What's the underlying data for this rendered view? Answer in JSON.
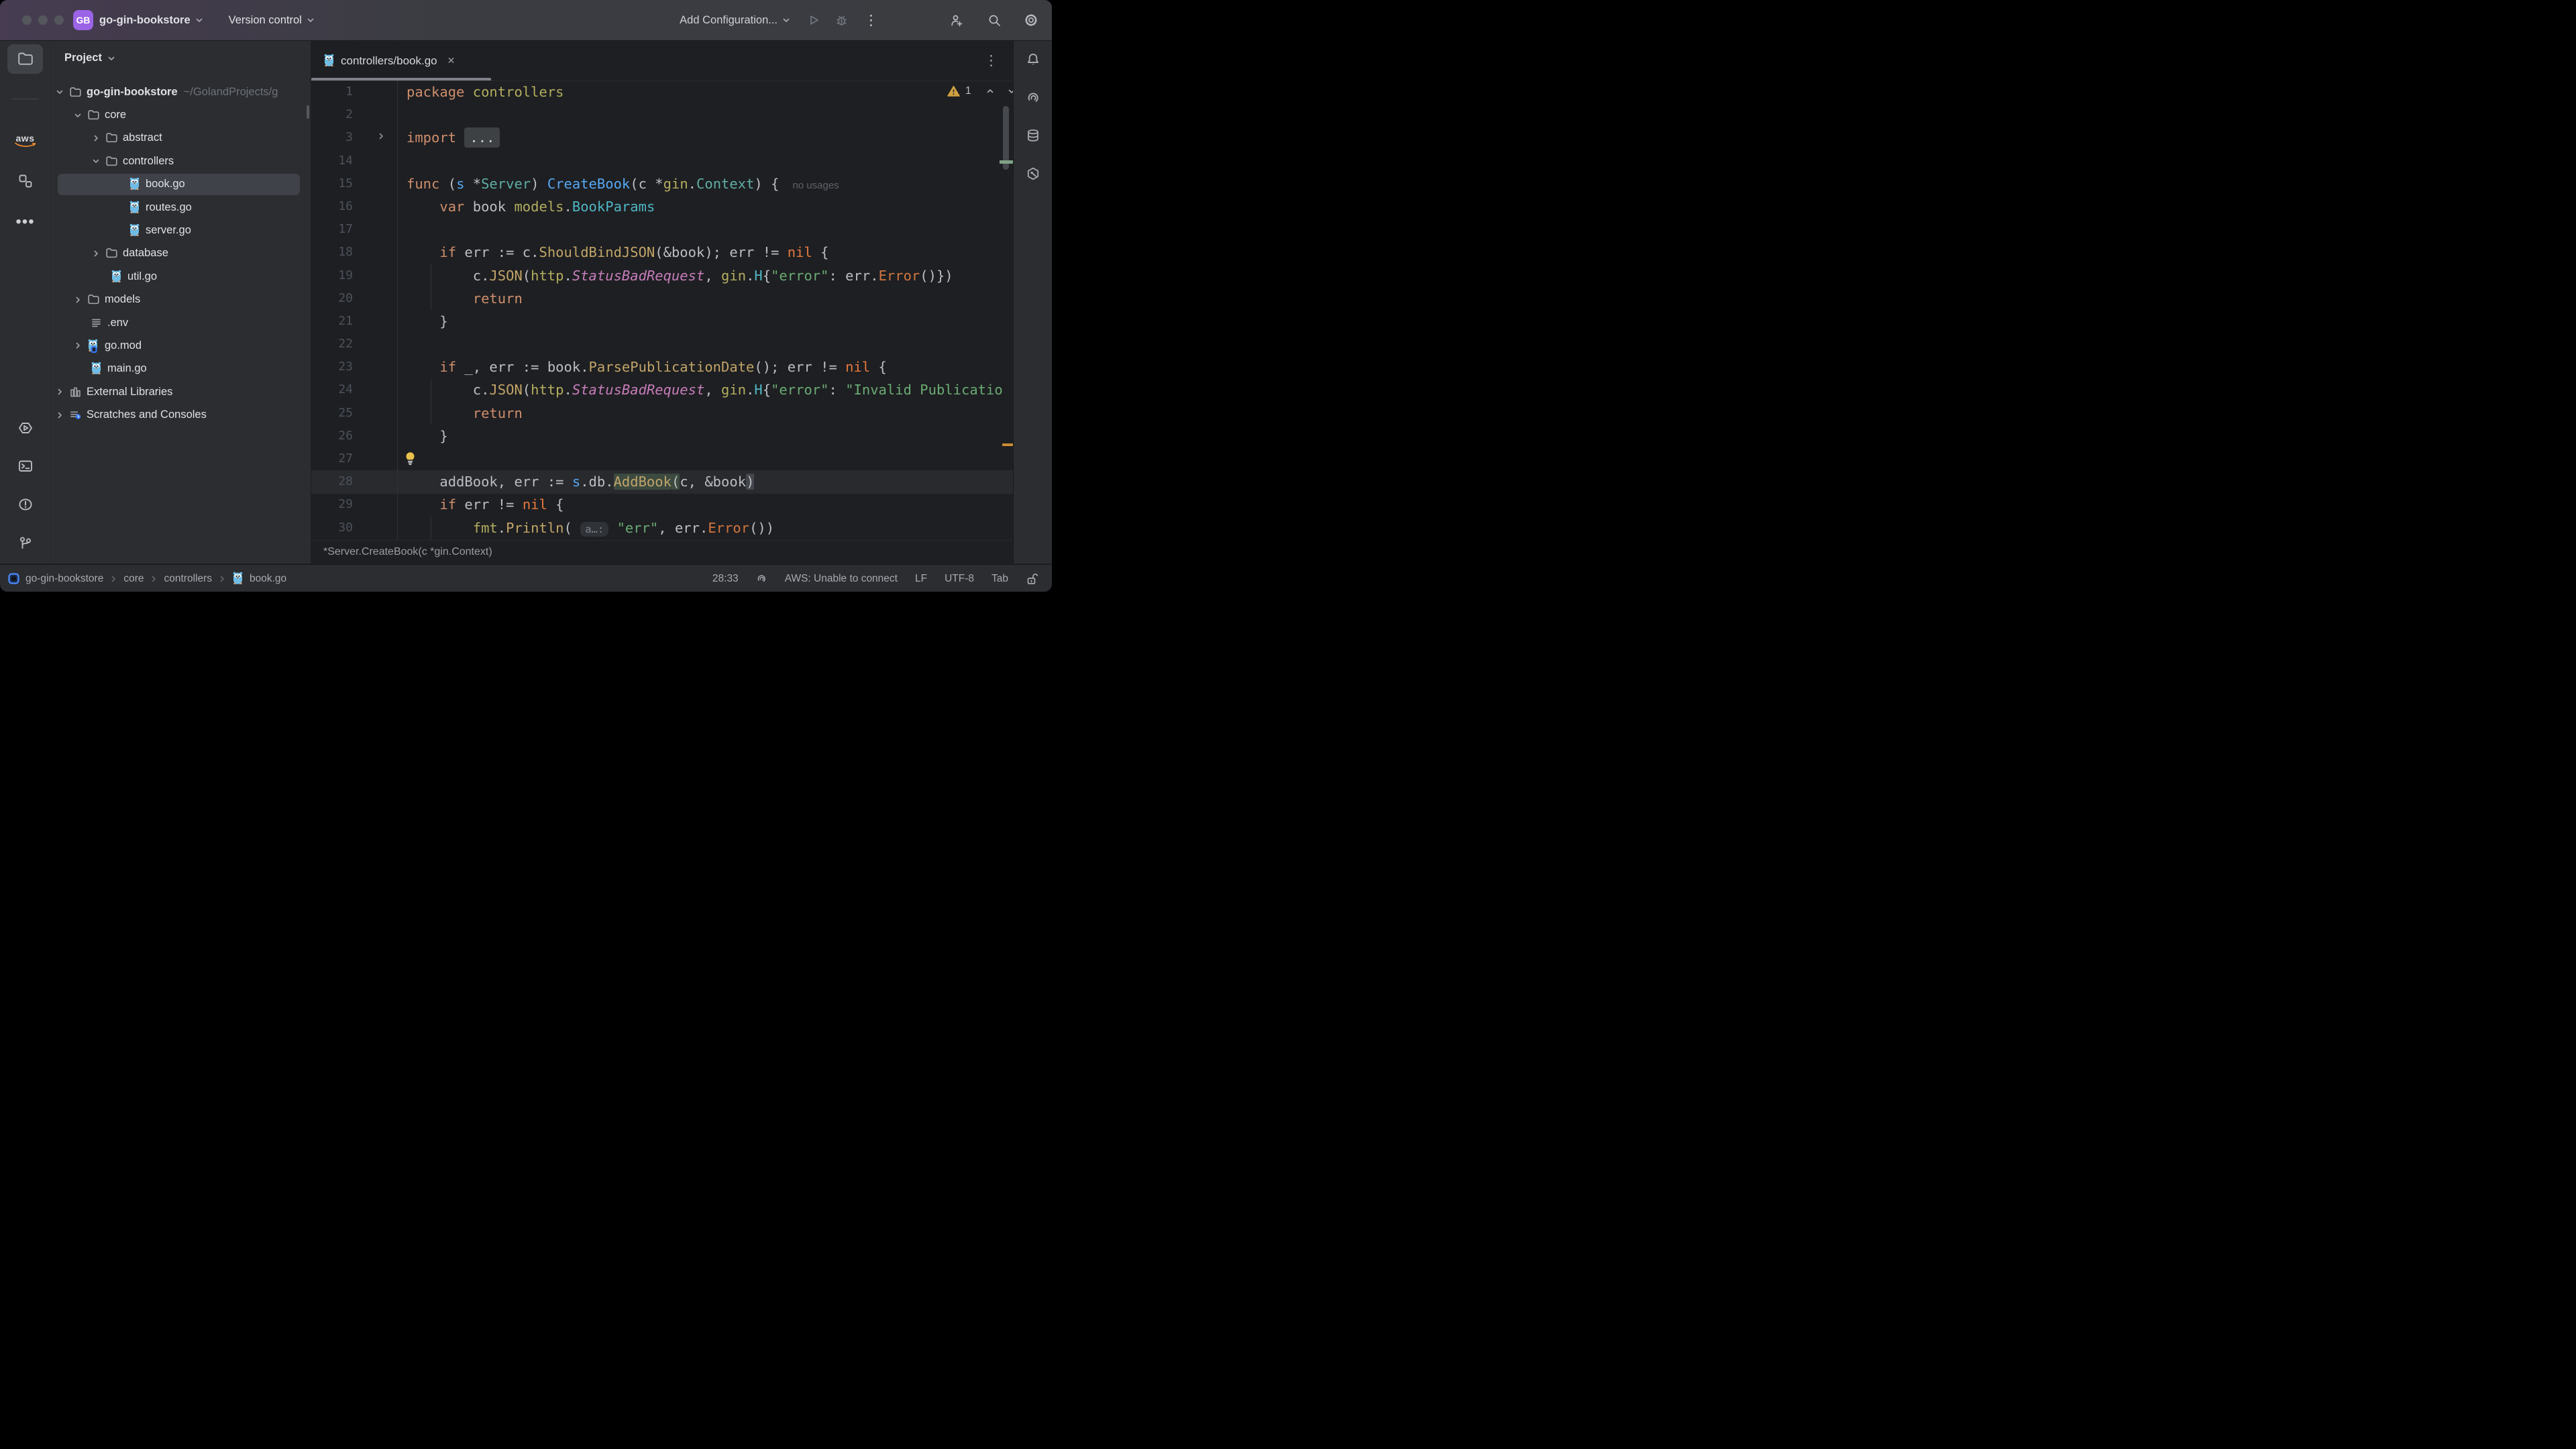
{
  "titlebar": {
    "project_badge": "GB",
    "project_name": "go-gin-bookstore",
    "vcs_label": "Version control",
    "run_config_label": "Add Configuration...",
    "right_icons": [
      {
        "name": "run-icon",
        "dim": true
      },
      {
        "name": "debug-icon",
        "dim": true
      },
      {
        "name": "more-vertical-icon"
      },
      {
        "name": "add-user-icon"
      },
      {
        "name": "search-icon"
      },
      {
        "name": "settings-icon"
      }
    ]
  },
  "left_toolbar": {
    "top": [
      {
        "name": "project-folder-icon",
        "active": true
      },
      {
        "name": "divider"
      },
      {
        "name": "aws-icon"
      },
      {
        "name": "structure-icon"
      },
      {
        "name": "more-horizontal-icon"
      }
    ],
    "bottom": [
      {
        "name": "run-hexagon-icon"
      },
      {
        "name": "terminal-icon"
      },
      {
        "name": "problems-icon"
      },
      {
        "name": "git-branch-icon"
      }
    ]
  },
  "project_panel": {
    "header": "Project",
    "rows": [
      {
        "label": "go-gin-bookstore",
        "path": "~/GolandProjects/g",
        "chevron": "open",
        "icon": "folder",
        "indent": 5,
        "bold": true
      },
      {
        "label": "core",
        "chevron": "open",
        "icon": "folder",
        "indent": 32
      },
      {
        "label": "abstract",
        "chevron": "closed",
        "icon": "folder",
        "indent": 59
      },
      {
        "label": "controllers",
        "chevron": "open",
        "icon": "folder",
        "indent": 59
      },
      {
        "label": "book.go",
        "chevron": null,
        "icon": "gopher",
        "indent": 115,
        "selected": true
      },
      {
        "label": "routes.go",
        "chevron": null,
        "icon": "gopher",
        "indent": 115
      },
      {
        "label": "server.go",
        "chevron": null,
        "icon": "gopher",
        "indent": 115
      },
      {
        "label": "database",
        "chevron": "closed",
        "icon": "folder",
        "indent": 59
      },
      {
        "label": "util.go",
        "chevron": null,
        "icon": "gopher",
        "indent": 88
      },
      {
        "label": "models",
        "chevron": "closed",
        "icon": "folder",
        "indent": 32
      },
      {
        "label": ".env",
        "chevron": null,
        "icon": "env",
        "indent": 58
      },
      {
        "label": "go.mod",
        "chevron": "closed",
        "icon": "gomod",
        "indent": 32
      },
      {
        "label": "main.go",
        "chevron": null,
        "icon": "gopher",
        "indent": 58
      },
      {
        "label": "External Libraries",
        "chevron": "closed",
        "icon": "extlib",
        "indent": 5
      },
      {
        "label": "Scratches and Consoles",
        "chevron": "closed",
        "icon": "scratches",
        "indent": 5
      }
    ]
  },
  "editor": {
    "tab": {
      "icon": "gopher-icon",
      "title": "controllers/book.go"
    },
    "tab_more_icon": "more-vertical-icon",
    "warnings": {
      "count": "1"
    },
    "breadcrumb": "*Server.CreateBook(c *gin.Context)",
    "fold_placeholder": "...",
    "usage_hint": "no usages",
    "inlay_hint": "a…:",
    "lines": [
      {
        "n": "1",
        "t": [
          [
            "k",
            "package"
          ],
          [
            "d",
            " "
          ],
          [
            "pkg",
            "controllers"
          ]
        ]
      },
      {
        "n": "2",
        "t": []
      },
      {
        "n": "3",
        "t": [
          [
            "k",
            "import"
          ],
          [
            "d",
            " "
          ],
          [
            "fold",
            "..."
          ]
        ],
        "gfold": true
      },
      {
        "n": "14",
        "t": []
      },
      {
        "n": "15",
        "t": [
          [
            "k",
            "func"
          ],
          [
            "d",
            " ("
          ],
          [
            "s",
            "s"
          ],
          [
            "d",
            " *"
          ],
          [
            "typ",
            "Server"
          ],
          [
            "d",
            ") "
          ],
          [
            "fn",
            "CreateBook"
          ],
          [
            "d",
            "(c *"
          ],
          [
            "pkg",
            "gin"
          ],
          [
            "d",
            "."
          ],
          [
            "typ",
            "Context"
          ],
          [
            "d",
            ") {"
          ],
          [
            "hint",
            "no usages"
          ]
        ]
      },
      {
        "n": "16",
        "t": [
          [
            "d",
            "    "
          ],
          [
            "k",
            "var"
          ],
          [
            "d",
            " book "
          ],
          [
            "pkg",
            "models"
          ],
          [
            "d",
            "."
          ],
          [
            "st",
            "BookParams"
          ]
        ]
      },
      {
        "n": "17",
        "t": []
      },
      {
        "n": "18",
        "t": [
          [
            "d",
            "    "
          ],
          [
            "k",
            "if"
          ],
          [
            "d",
            " err := c."
          ],
          [
            "call",
            "ShouldBindJSON"
          ],
          [
            "d",
            "(&book); err != "
          ],
          [
            "nil",
            "nil"
          ],
          [
            "d",
            " {"
          ]
        ]
      },
      {
        "n": "19",
        "t": [
          [
            "d",
            "        c."
          ],
          [
            "call",
            "JSON"
          ],
          [
            "d",
            "("
          ],
          [
            "pkg",
            "http"
          ],
          [
            "d",
            "."
          ],
          [
            "const",
            "StatusBadRequest"
          ],
          [
            "d",
            ", "
          ],
          [
            "pkg",
            "gin"
          ],
          [
            "d",
            "."
          ],
          [
            "st",
            "H"
          ],
          [
            "d",
            "{"
          ],
          [
            "str",
            "\"error\""
          ],
          [
            "d",
            ": err."
          ],
          [
            "callo",
            "Error"
          ],
          [
            "d",
            "()})"
          ]
        ]
      },
      {
        "n": "20",
        "t": [
          [
            "d",
            "        "
          ],
          [
            "k",
            "return"
          ]
        ]
      },
      {
        "n": "21",
        "t": [
          [
            "d",
            "    }"
          ]
        ]
      },
      {
        "n": "22",
        "t": []
      },
      {
        "n": "23",
        "t": [
          [
            "d",
            "    "
          ],
          [
            "k",
            "if"
          ],
          [
            "d",
            " _, err := book."
          ],
          [
            "call",
            "ParsePublicationDate"
          ],
          [
            "d",
            "(); err != "
          ],
          [
            "nil",
            "nil"
          ],
          [
            "d",
            " {"
          ]
        ]
      },
      {
        "n": "24",
        "t": [
          [
            "d",
            "        c."
          ],
          [
            "call",
            "JSON"
          ],
          [
            "d",
            "("
          ],
          [
            "pkg",
            "http"
          ],
          [
            "d",
            "."
          ],
          [
            "const",
            "StatusBadRequest"
          ],
          [
            "d",
            ", "
          ],
          [
            "pkg",
            "gin"
          ],
          [
            "d",
            "."
          ],
          [
            "st",
            "H"
          ],
          [
            "d",
            "{"
          ],
          [
            "str",
            "\"error\""
          ],
          [
            "d",
            ": "
          ],
          [
            "str",
            "\"Invalid Publicatio"
          ]
        ]
      },
      {
        "n": "25",
        "t": [
          [
            "d",
            "        "
          ],
          [
            "k",
            "return"
          ]
        ]
      },
      {
        "n": "26",
        "t": [
          [
            "d",
            "    }"
          ]
        ]
      },
      {
        "n": "27",
        "t": [],
        "bulb": true
      },
      {
        "n": "28",
        "t": [
          [
            "d",
            "    addBook, err := "
          ],
          [
            "s",
            "s"
          ],
          [
            "d",
            ".db."
          ],
          [
            "hlg",
            "AddBook"
          ],
          [
            "hlgp",
            "("
          ],
          [
            "d",
            "c, &book"
          ],
          [
            "hlp",
            ")"
          ]
        ],
        "cur": true
      },
      {
        "n": "29",
        "t": [
          [
            "d",
            "    "
          ],
          [
            "k",
            "if"
          ],
          [
            "d",
            " err != "
          ],
          [
            "nil",
            "nil"
          ],
          [
            "d",
            " {"
          ]
        ]
      },
      {
        "n": "30",
        "t": [
          [
            "d",
            "        "
          ],
          [
            "pkg",
            "fmt"
          ],
          [
            "d",
            "."
          ],
          [
            "call",
            "Println"
          ],
          [
            "d",
            "( "
          ],
          [
            "inlay",
            "a…:"
          ],
          [
            "d",
            " "
          ],
          [
            "str",
            "\"err\""
          ],
          [
            "d",
            ", err."
          ],
          [
            "callo",
            "Error"
          ],
          [
            "d",
            "())"
          ]
        ]
      }
    ]
  },
  "right_toolbar": {
    "icons": [
      {
        "name": "notifications-bell-icon"
      },
      {
        "name": "ai-assistant-icon"
      },
      {
        "name": "database-icon"
      },
      {
        "name": "package-checker-icon"
      }
    ]
  },
  "statusbar": {
    "path": [
      "go-gin-bookstore",
      "core",
      "controllers",
      "book.go"
    ],
    "caret_position": "28:33",
    "aws_status": "AWS: Unable to connect",
    "line_separator": "LF",
    "encoding": "UTF-8",
    "indent_style": "Tab"
  },
  "colors": {
    "accent_blue": "#3574F0",
    "project_badge": "#9B63E6",
    "warning_yellow": "#CFA240",
    "gopher_blue": "#6FBCE6",
    "aws_orange": "#E8862D"
  }
}
